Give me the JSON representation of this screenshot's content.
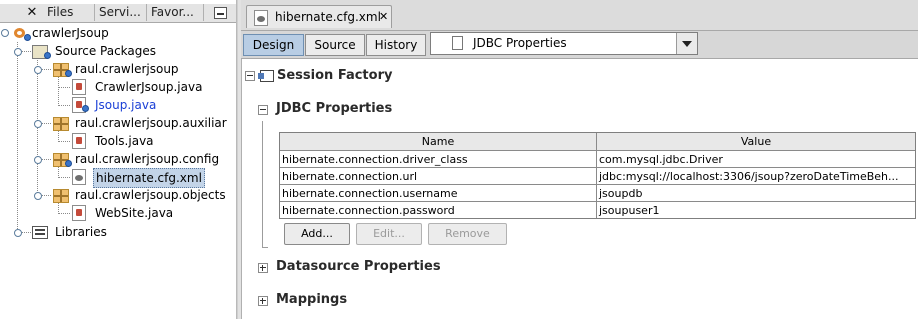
{
  "left_panel": {
    "tabs": [
      "Files",
      "Servi...",
      "Favor..."
    ],
    "tree": {
      "project": "crawlerJsoup",
      "source_packages": "Source Packages",
      "packages": [
        {
          "name": "raul.crawlerjsoup",
          "files": [
            "CrawlerJsoup.java",
            "Jsoup.java"
          ]
        },
        {
          "name": "raul.crawlerjsoup.auxiliar",
          "files": [
            "Tools.java"
          ]
        },
        {
          "name": "raul.crawlerjsoup.config",
          "files": [
            "hibernate.cfg.xml"
          ]
        },
        {
          "name": "raul.crawlerjsoup.objects",
          "files": [
            "WebSite.java"
          ]
        }
      ],
      "libraries": "Libraries"
    }
  },
  "editor": {
    "tab_title": "hibernate.cfg.xml",
    "view_buttons": [
      "Design",
      "Source",
      "History"
    ],
    "active_view": "Design",
    "view_select": "JDBC Properties",
    "sections": {
      "session_factory": "Session Factory",
      "jdbc_properties": "JDBC Properties",
      "datasource_properties": "Datasource Properties",
      "mappings": "Mappings"
    },
    "table": {
      "headers": [
        "Name",
        "Value"
      ],
      "rows": [
        [
          "hibernate.connection.driver_class",
          "com.mysql.jdbc.Driver"
        ],
        [
          "hibernate.connection.url",
          "jdbc:mysql://localhost:3306/jsoup?zeroDateTimeBeh..."
        ],
        [
          "hibernate.connection.username",
          "jsoupdb"
        ],
        [
          "hibernate.connection.password",
          "jsoupuser1"
        ]
      ]
    },
    "table_buttons": {
      "add": "Add...",
      "edit": "Edit...",
      "remove": "Remove"
    }
  },
  "colors": {
    "selection": "#c3d4e8",
    "active_view_button": "#b8cde4",
    "jsoup_file_text": "#1a3fd6"
  }
}
